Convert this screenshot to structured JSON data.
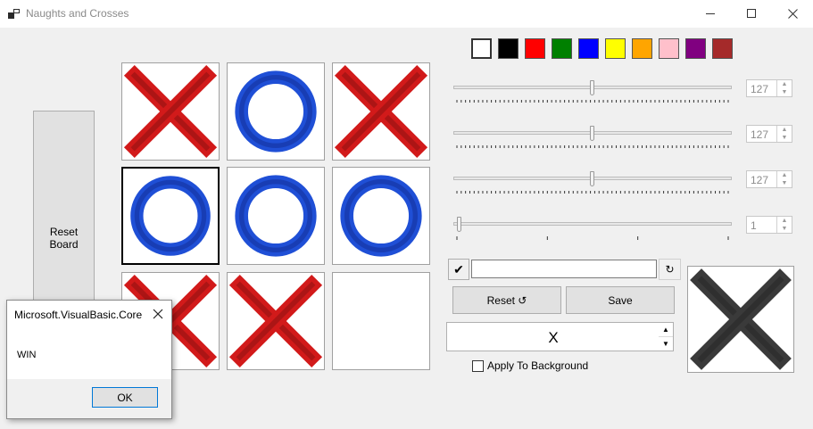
{
  "window": {
    "title": "Naughts and Crosses",
    "icon": "app-icon",
    "controls": [
      "minimize-icon",
      "maximize-icon",
      "close-icon"
    ]
  },
  "reset_board": {
    "label_line1": "Reset",
    "label_line2": "Board"
  },
  "board": {
    "cells": [
      "X",
      "O",
      "X",
      "O",
      "O",
      "O",
      "X",
      "X",
      ""
    ],
    "selected_cell": 3,
    "x_color": "#d21a1a",
    "o_color": "#1f4fd6"
  },
  "palette": [
    "#ffffff",
    "#000000",
    "#ff0000",
    "#008000",
    "#0000ff",
    "#ffff00",
    "#ffa500",
    "#ffc0cb",
    "#800080",
    "#a52a2a"
  ],
  "sliders": [
    {
      "value": "127",
      "fraction": 0.498
    },
    {
      "value": "127",
      "fraction": 0.498
    },
    {
      "value": "127",
      "fraction": 0.498
    },
    {
      "value": "1",
      "fraction": 0.0
    }
  ],
  "controls": {
    "check_glyph": "✔",
    "text_value": "",
    "refresh_glyph": "↻",
    "reset_label": "Reset ↺",
    "save_label": "Save",
    "symbol_value": "X",
    "apply_bg_label": "Apply To Background",
    "apply_bg_checked": false
  },
  "preview": {
    "symbol": "X",
    "color": "#3a3a3a"
  },
  "dialog": {
    "title": "Microsoft.VisualBasic.Core",
    "message": "WIN",
    "ok_label": "OK"
  }
}
